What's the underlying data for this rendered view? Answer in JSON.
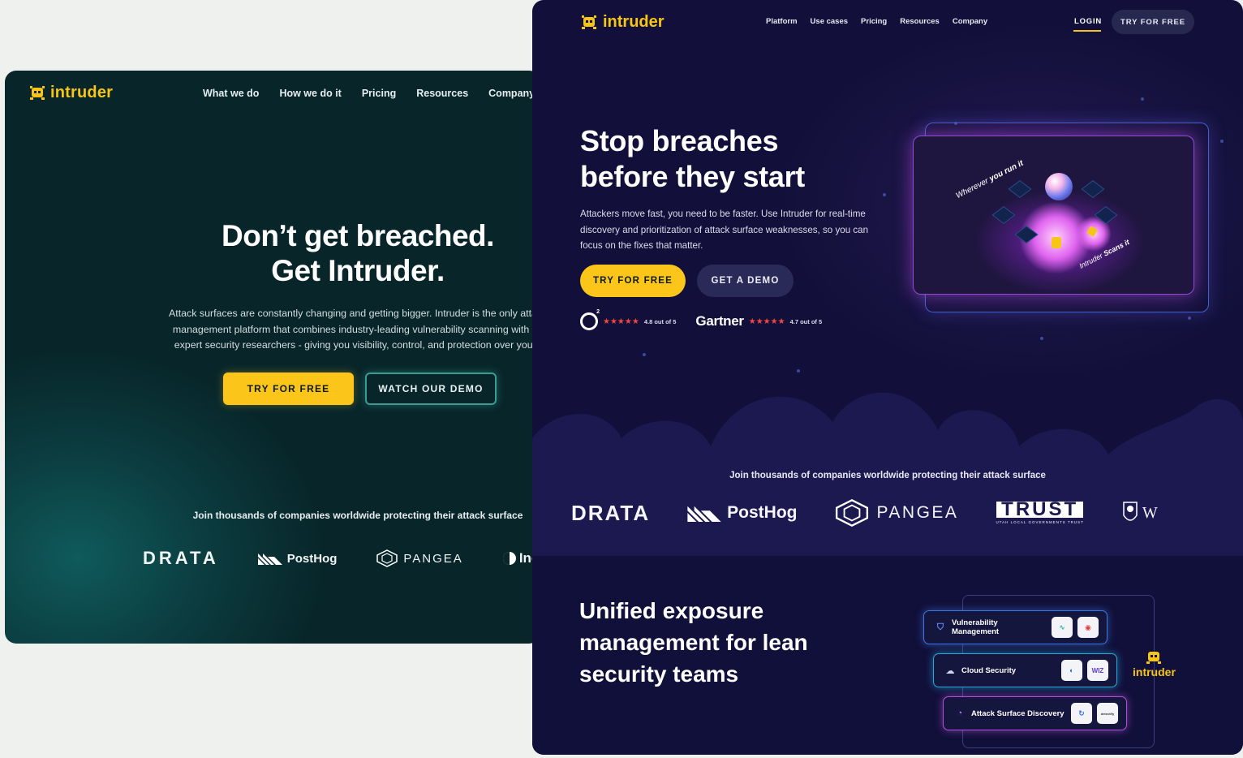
{
  "back_site": {
    "logo_text": "intruder",
    "nav": [
      "What we do",
      "How we do it",
      "Pricing",
      "Resources",
      "Company"
    ],
    "headline": [
      "Don’t get breached.",
      "Get Intruder."
    ],
    "paragraph": [
      "Attack surfaces are constantly changing and getting bigger. Intruder is the only attack s",
      "management platform that combines industry-leading vulnerability scanning with inpu",
      "expert security researchers - giving you visibility, control, and protection over your as"
    ],
    "cta_primary": "TRY FOR FREE",
    "cta_secondary": "WATCH OUR DEMO",
    "join_text": "Join thousands of companies worldwide protecting their attack surface",
    "logos": {
      "drata": "DRATA",
      "posthog": "PostHog",
      "pangea": "PANGEA",
      "inc": "Inc"
    }
  },
  "front_site": {
    "logo_text": "intruder",
    "nav": [
      "Platform",
      "Use cases",
      "Pricing",
      "Resources",
      "Company"
    ],
    "login": "LOGIN",
    "try_nav": "TRY FOR FREE",
    "headline": [
      "Stop breaches",
      "before they start"
    ],
    "paragraph": "Attackers move fast, you need to be faster. Use Intruder for real-time discovery and prioritization of attack surface weaknesses, so you can focus on the fixes that matter.",
    "cta_primary": "TRY FOR FREE",
    "cta_secondary": "GET A DEMO",
    "ratings": {
      "g2_badge": "2",
      "g2_stars": "★★★★★",
      "g2_score": "4.8 out of 5",
      "gartner": "Gartner",
      "gartner_stars": "★★★★★",
      "gartner_score": "4.7 out of 5"
    },
    "hero_image": {
      "text1_plain": "Wherever ",
      "text1_bold": "you run it",
      "text2_plain": "Intruder ",
      "text2_bold": "Scans it"
    },
    "join_text": "Join thousands of companies worldwide protecting their attack surface",
    "logos": {
      "drata": "DRATA",
      "posthog": "PostHog",
      "pangea": "PANGEA",
      "trust": "TRUST",
      "trust_sub": "UTAH LOCAL GOVERNMENTS TRUST",
      "w": "W"
    },
    "section_heading": [
      "Unified exposure",
      "management for lean",
      "security teams"
    ],
    "capabilities": [
      {
        "label": "Vulnerability Management"
      },
      {
        "label": "Cloud Security",
        "logo2": "WIZ"
      },
      {
        "label": "Attack Surface Discovery",
        "logo2": "detectify"
      }
    ],
    "intruder_badge": "intruder"
  },
  "colors": {
    "accent_yellow": "#fbc51a",
    "back_bg": "#0a2629",
    "front_bg": "#12103a"
  }
}
